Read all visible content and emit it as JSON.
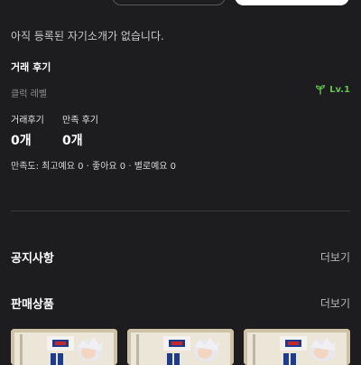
{
  "top_buttons": {
    "left_label": "",
    "right_label": ""
  },
  "profile": {
    "intro_text": "아직 등록된 자기소개가 없습니다."
  },
  "reviews": {
    "title": "거래 후기",
    "click_level_label": "클럭 레벨",
    "level": "Lv.1",
    "stats": [
      {
        "label": "거래후기",
        "value": "0개"
      },
      {
        "label": "만족 후기",
        "value": "0개"
      }
    ],
    "satisfaction_text": "만족도: 최고예요 0 · 좋아요 0 · 별로예요 0"
  },
  "notice": {
    "title": "공지사항",
    "more": "더보기"
  },
  "sales": {
    "title": "판매상품",
    "more": "더보기",
    "products": [
      {
        "icon": "figure-box-image"
      },
      {
        "icon": "figure-box-image"
      },
      {
        "icon": "figure-box-image"
      }
    ]
  },
  "colors": {
    "background": "#1d1d1f",
    "accent_green": "#62c24c"
  }
}
